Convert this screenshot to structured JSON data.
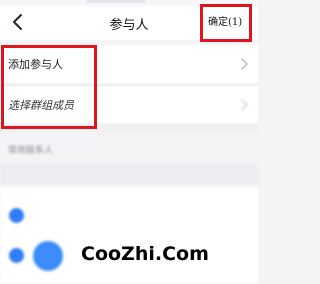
{
  "navbar": {
    "title": "参与人",
    "confirm_label": "确定(1)",
    "back_icon": "chevron-left-icon"
  },
  "rows": [
    {
      "label": "添加参与人",
      "icon": "chevron-right-icon"
    },
    {
      "label": "选择群组成员",
      "icon": "chevron-right-icon"
    }
  ],
  "recent": {
    "label": "常用联系人"
  },
  "members": [
    {
      "name": "",
      "selected": true
    },
    {
      "name": "",
      "selected": true
    }
  ],
  "watermark": "CooZhi.Com",
  "colors": {
    "highlight": "#e0141c",
    "accent": "#2f7cf6"
  }
}
